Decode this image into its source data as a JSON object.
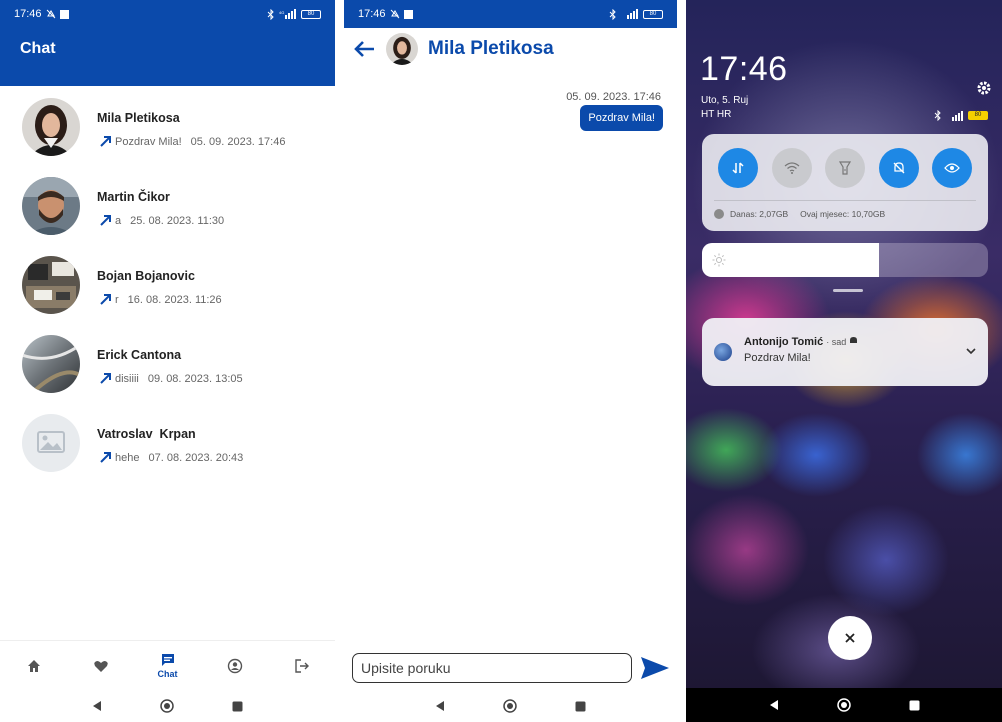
{
  "phone1": {
    "status": {
      "time": "17:46",
      "network": "4G+"
    },
    "header_title": "Chat",
    "chats": [
      {
        "name": "Mila Pletikosa",
        "last_message": "Pozdrav Mila!",
        "timestamp": "05. 09. 2023. 17:46",
        "avatar": "photo-woman"
      },
      {
        "name": "Martin Čikor",
        "last_message": "a",
        "timestamp": "25. 08. 2023. 11:30",
        "avatar": "photo-man-beard"
      },
      {
        "name": "Bojan Bojanovic",
        "last_message": "r",
        "timestamp": "16. 08. 2023. 11:26",
        "avatar": "photo-desk"
      },
      {
        "name": "Erick Cantona",
        "last_message": "disiiii",
        "timestamp": "09. 08. 2023. 13:05",
        "avatar": "photo-glass"
      },
      {
        "name": "Vatroslav  Krpan",
        "last_message": "hehe",
        "timestamp": "07. 08. 2023. 20:43",
        "avatar": "placeholder-image-icon"
      }
    ],
    "bottom_nav": [
      {
        "icon": "home-icon",
        "label": ""
      },
      {
        "icon": "heart-icon",
        "label": ""
      },
      {
        "icon": "chat-icon",
        "label": "Chat",
        "active": true
      },
      {
        "icon": "profile-icon",
        "label": ""
      },
      {
        "icon": "logout-icon",
        "label": ""
      }
    ]
  },
  "phone2": {
    "status": {
      "time": "17:46"
    },
    "contact_name": "Mila Pletikosa",
    "messages": [
      {
        "time": "05. 09. 2023. 17:46",
        "text": "Pozdrav Mila!",
        "outgoing": true
      }
    ],
    "input_placeholder": "Upisite poruku"
  },
  "phone3": {
    "time": "17:46",
    "date": "Uto, 5. Ruj",
    "carrier": "HT HR",
    "quick_settings": [
      {
        "icon": "data-transfer-icon",
        "on": true
      },
      {
        "icon": "wifi-icon",
        "on": false
      },
      {
        "icon": "flashlight-icon",
        "on": false
      },
      {
        "icon": "bell-mute-icon",
        "on": true
      },
      {
        "icon": "eye-icon",
        "on": true
      }
    ],
    "data_usage": {
      "today": "Danas: 2,07GB",
      "month": "Ovaj mjesec: 10,70GB"
    },
    "brightness_level": 0.62,
    "notification": {
      "app_name": "Antonijo Tomić",
      "when": "· sad",
      "text": "Pozdrav Mila!"
    }
  },
  "colors": {
    "brand_blue": "#0b4aab",
    "tile_on": "#1e88e5"
  }
}
